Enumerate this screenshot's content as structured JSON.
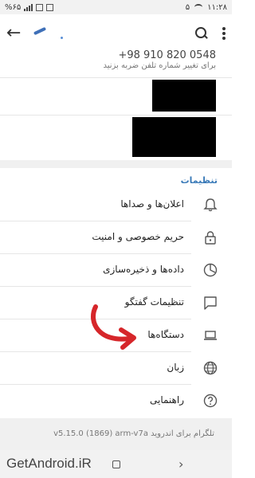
{
  "status_bar": {
    "battery": "%۶۵",
    "sim": "۵",
    "time": "۱۱:۲۸"
  },
  "toolbar": {
    "back_icon": "back-arrow-icon",
    "search_icon": "search-icon",
    "menu_icon": "more-vertical-icon"
  },
  "account": {
    "phone_number": "+98 910 820 0548",
    "phone_hint": "برای تغییر شماره تلفن ضربه بزنید"
  },
  "settings": {
    "title": "تنظیمات",
    "items": [
      {
        "label": "اعلان‌ها و صداها",
        "icon": "bell-icon"
      },
      {
        "label": "حریم خصوصی و امنیت",
        "icon": "lock-icon"
      },
      {
        "label": "داده‌ها و ذخیره‌سازی",
        "icon": "data-usage-icon"
      },
      {
        "label": "تنظیمات گفتگو",
        "icon": "chat-bubble-icon"
      },
      {
        "label": "دستگاه‌ها",
        "icon": "laptop-icon"
      },
      {
        "label": "زبان",
        "icon": "globe-icon"
      },
      {
        "label": "راهنمایی",
        "icon": "help-icon"
      }
    ]
  },
  "footer": {
    "version": "تلگرام برای اندروید v5.15.0 (1869) arm-v7a"
  },
  "watermark": "GetAndroid.iR",
  "colors": {
    "accent": "#3a7ab8",
    "annotation_arrow": "#d6262a"
  }
}
